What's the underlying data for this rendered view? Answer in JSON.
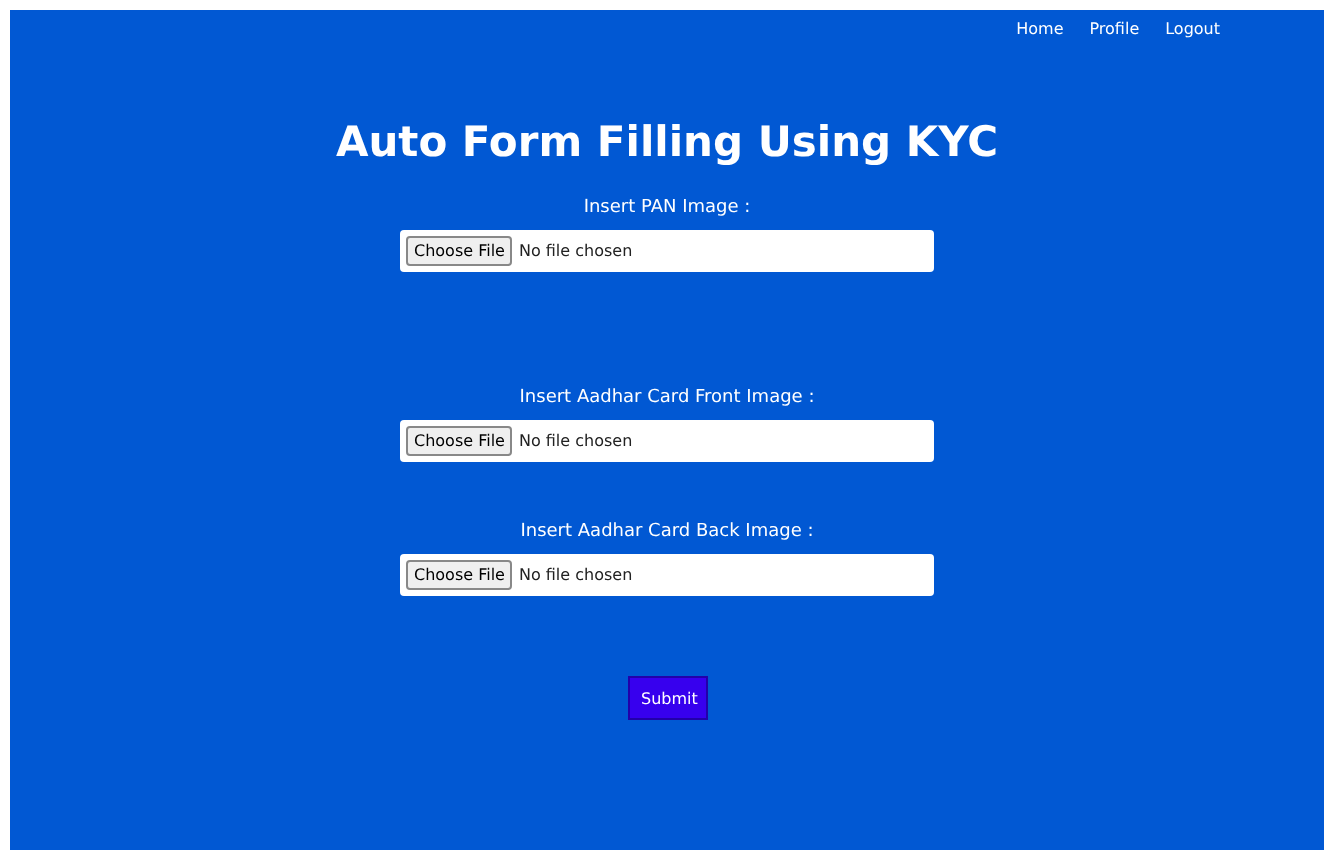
{
  "nav": [
    "Home",
    "Profile",
    "Logout"
  ],
  "title": "Auto Form Filling Using KYC",
  "fields": [
    {
      "label": "Insert PAN Image :",
      "button": "Choose File",
      "status": "No file chosen"
    },
    {
      "label": "Insert Aadhar Card Front Image :",
      "button": "Choose File",
      "status": "No file chosen"
    },
    {
      "label": "Insert Aadhar Card Back Image :",
      "button": "Choose File",
      "status": "No file chosen"
    }
  ],
  "submit": "Submit"
}
